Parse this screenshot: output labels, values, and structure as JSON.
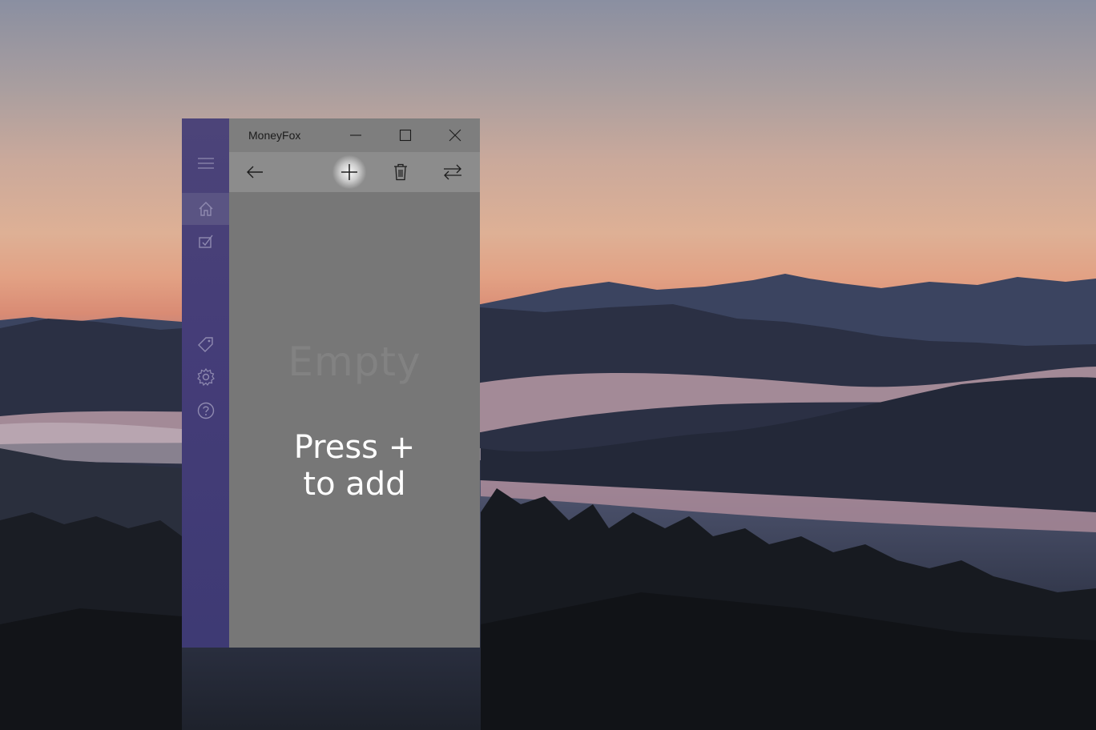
{
  "window": {
    "title": "MoneyFox",
    "caption_buttons": [
      "minimize-icon",
      "maximize-icon",
      "close-icon"
    ]
  },
  "sidebar": {
    "menu_icon": "hamburger-icon",
    "items": [
      {
        "icon": "home-icon",
        "selected": true
      },
      {
        "icon": "statistics-icon",
        "selected": false
      },
      {
        "icon": "category-icon",
        "selected": false
      },
      {
        "icon": "settings-icon",
        "selected": false
      },
      {
        "icon": "help-icon",
        "selected": false
      }
    ]
  },
  "commandbar": {
    "items": [
      "back-arrow-icon",
      "add-icon",
      "delete-icon",
      "transfer-icon"
    ]
  },
  "content": {
    "empty_label": "Empty",
    "hint_line1": "Press +",
    "hint_line2": "to add"
  },
  "colors": {
    "sidebar": "#453d78",
    "sidebar_selected": "#5a5483",
    "content": "#777777",
    "titlebar": "#7e7e7e",
    "commandbar": "#8c8c8c"
  }
}
